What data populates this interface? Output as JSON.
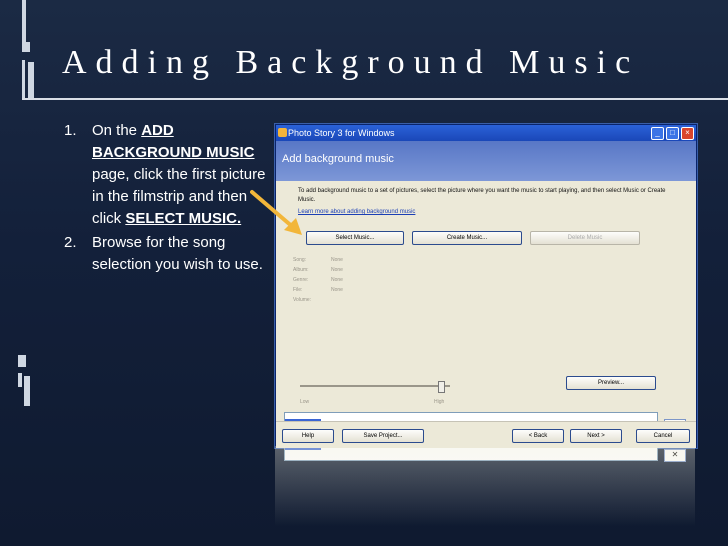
{
  "slide": {
    "title": "Adding Background Music",
    "steps": [
      {
        "num": "1.",
        "before": "On the ",
        "bold1": "ADD BACKGROUND MUSIC",
        "middle": " page, click the first picture in the filmstrip and then click ",
        "bold2": "SELECT MUSIC.",
        "after": ""
      },
      {
        "num": "2.",
        "text": "Browse for the song selection you wish to use."
      }
    ]
  },
  "window": {
    "title": "Photo Story 3 for Windows",
    "header": "Add background music",
    "description": "To add background music to a set of pictures, select the picture where you want the music to start playing, and then select Music or Create Music.",
    "learn_more": "Learn more about adding background music",
    "buttons": {
      "select": "Select Music...",
      "create": "Create Music...",
      "delete": "Delete Music",
      "preview": "Preview..."
    },
    "fields": [
      {
        "label": "Song:",
        "value": "None"
      },
      {
        "label": "Album:",
        "value": "None"
      },
      {
        "label": "Genre:",
        "value": "None"
      },
      {
        "label": "File:",
        "value": "None"
      },
      {
        "label": "Volume:",
        "value": ""
      }
    ],
    "volume": {
      "low": "Low",
      "high": "High",
      "level": 0.95
    },
    "footer": {
      "help": "Help",
      "save": "Save Project...",
      "back": "< Back",
      "next": "Next >",
      "cancel": "Cancel"
    }
  },
  "colors": {
    "background": "#13203a",
    "accent": "#f2b63a",
    "header": "#5877c6"
  }
}
